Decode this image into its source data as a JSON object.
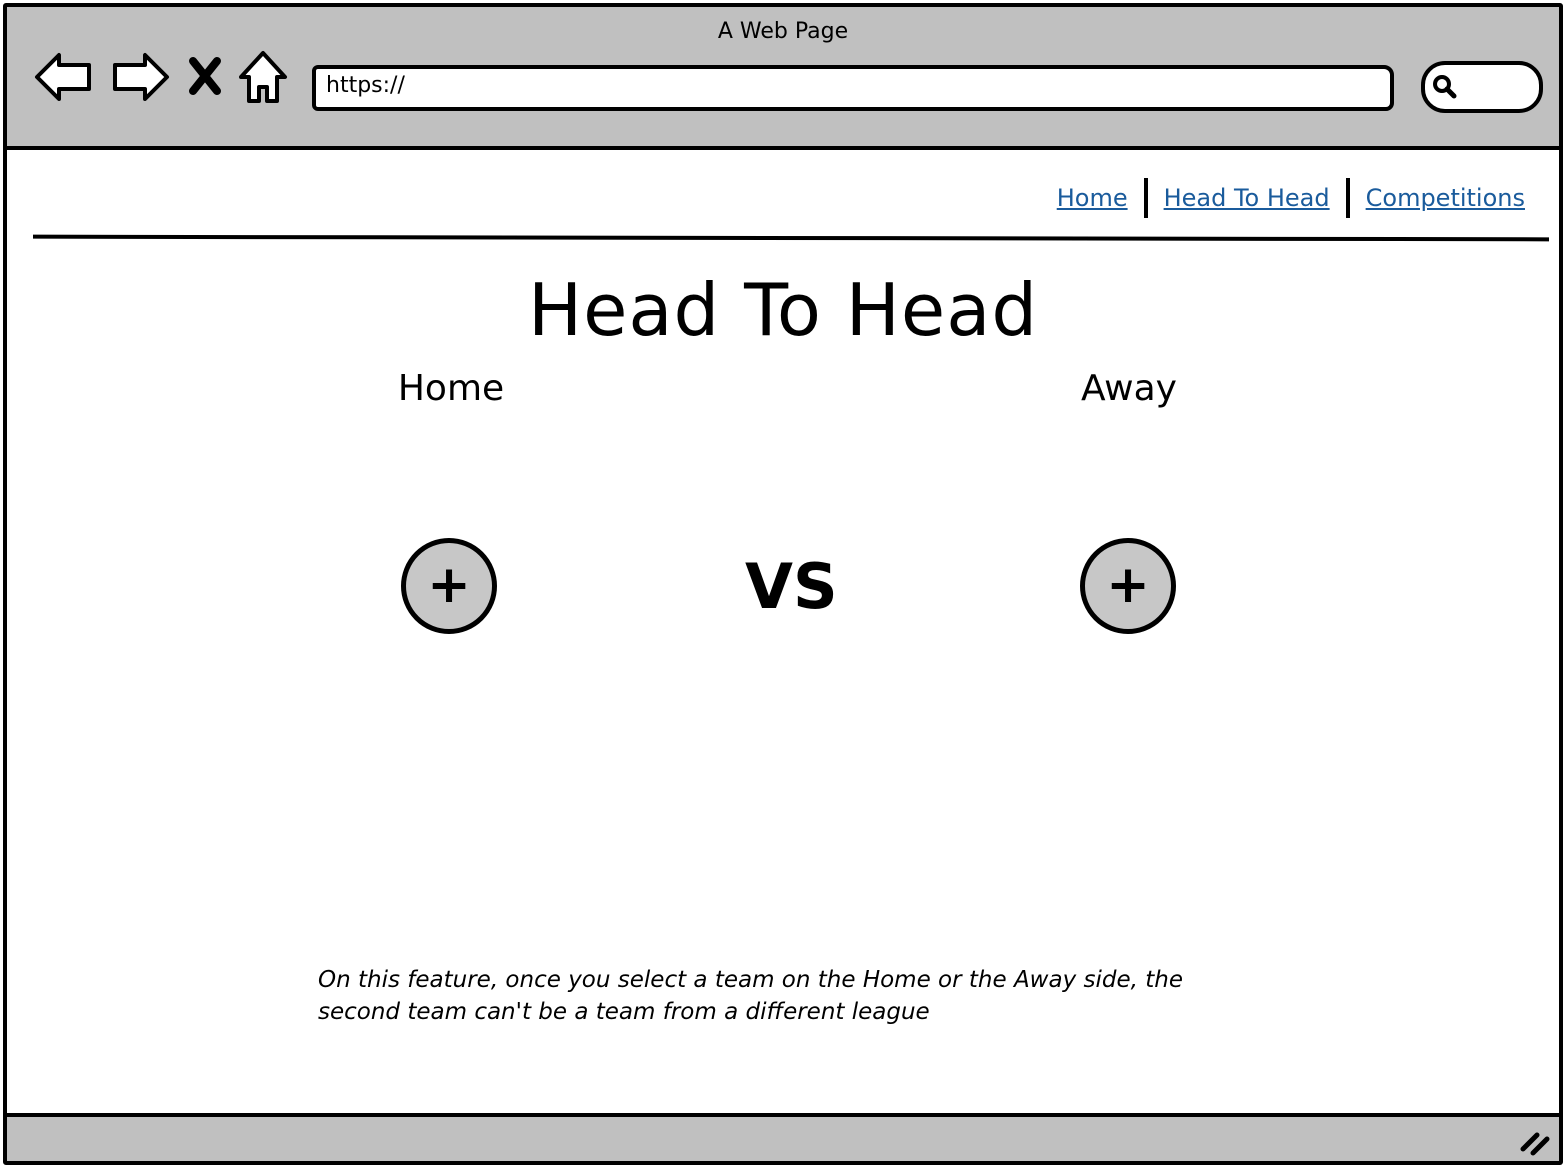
{
  "window": {
    "title": "A Web Page"
  },
  "toolbar": {
    "url": "https://",
    "icons": [
      "back-arrow-icon",
      "forward-arrow-icon",
      "close-icon",
      "home-icon",
      "search-icon"
    ]
  },
  "nav": {
    "links": [
      {
        "label": "Home"
      },
      {
        "label": "Head To Head"
      },
      {
        "label": "Competitions"
      }
    ],
    "link_color": "#1a5b9c"
  },
  "main": {
    "title": "Head To Head",
    "home_label": "Home",
    "away_label": "Away",
    "add_symbol": "+",
    "vs_label": "VS",
    "note": "On this feature, once you select a team on the Home or the Away side, the second team can't be a team from a different league"
  },
  "colors": {
    "chrome": "#c0c0c0",
    "button_fill": "#c7c7c7"
  }
}
